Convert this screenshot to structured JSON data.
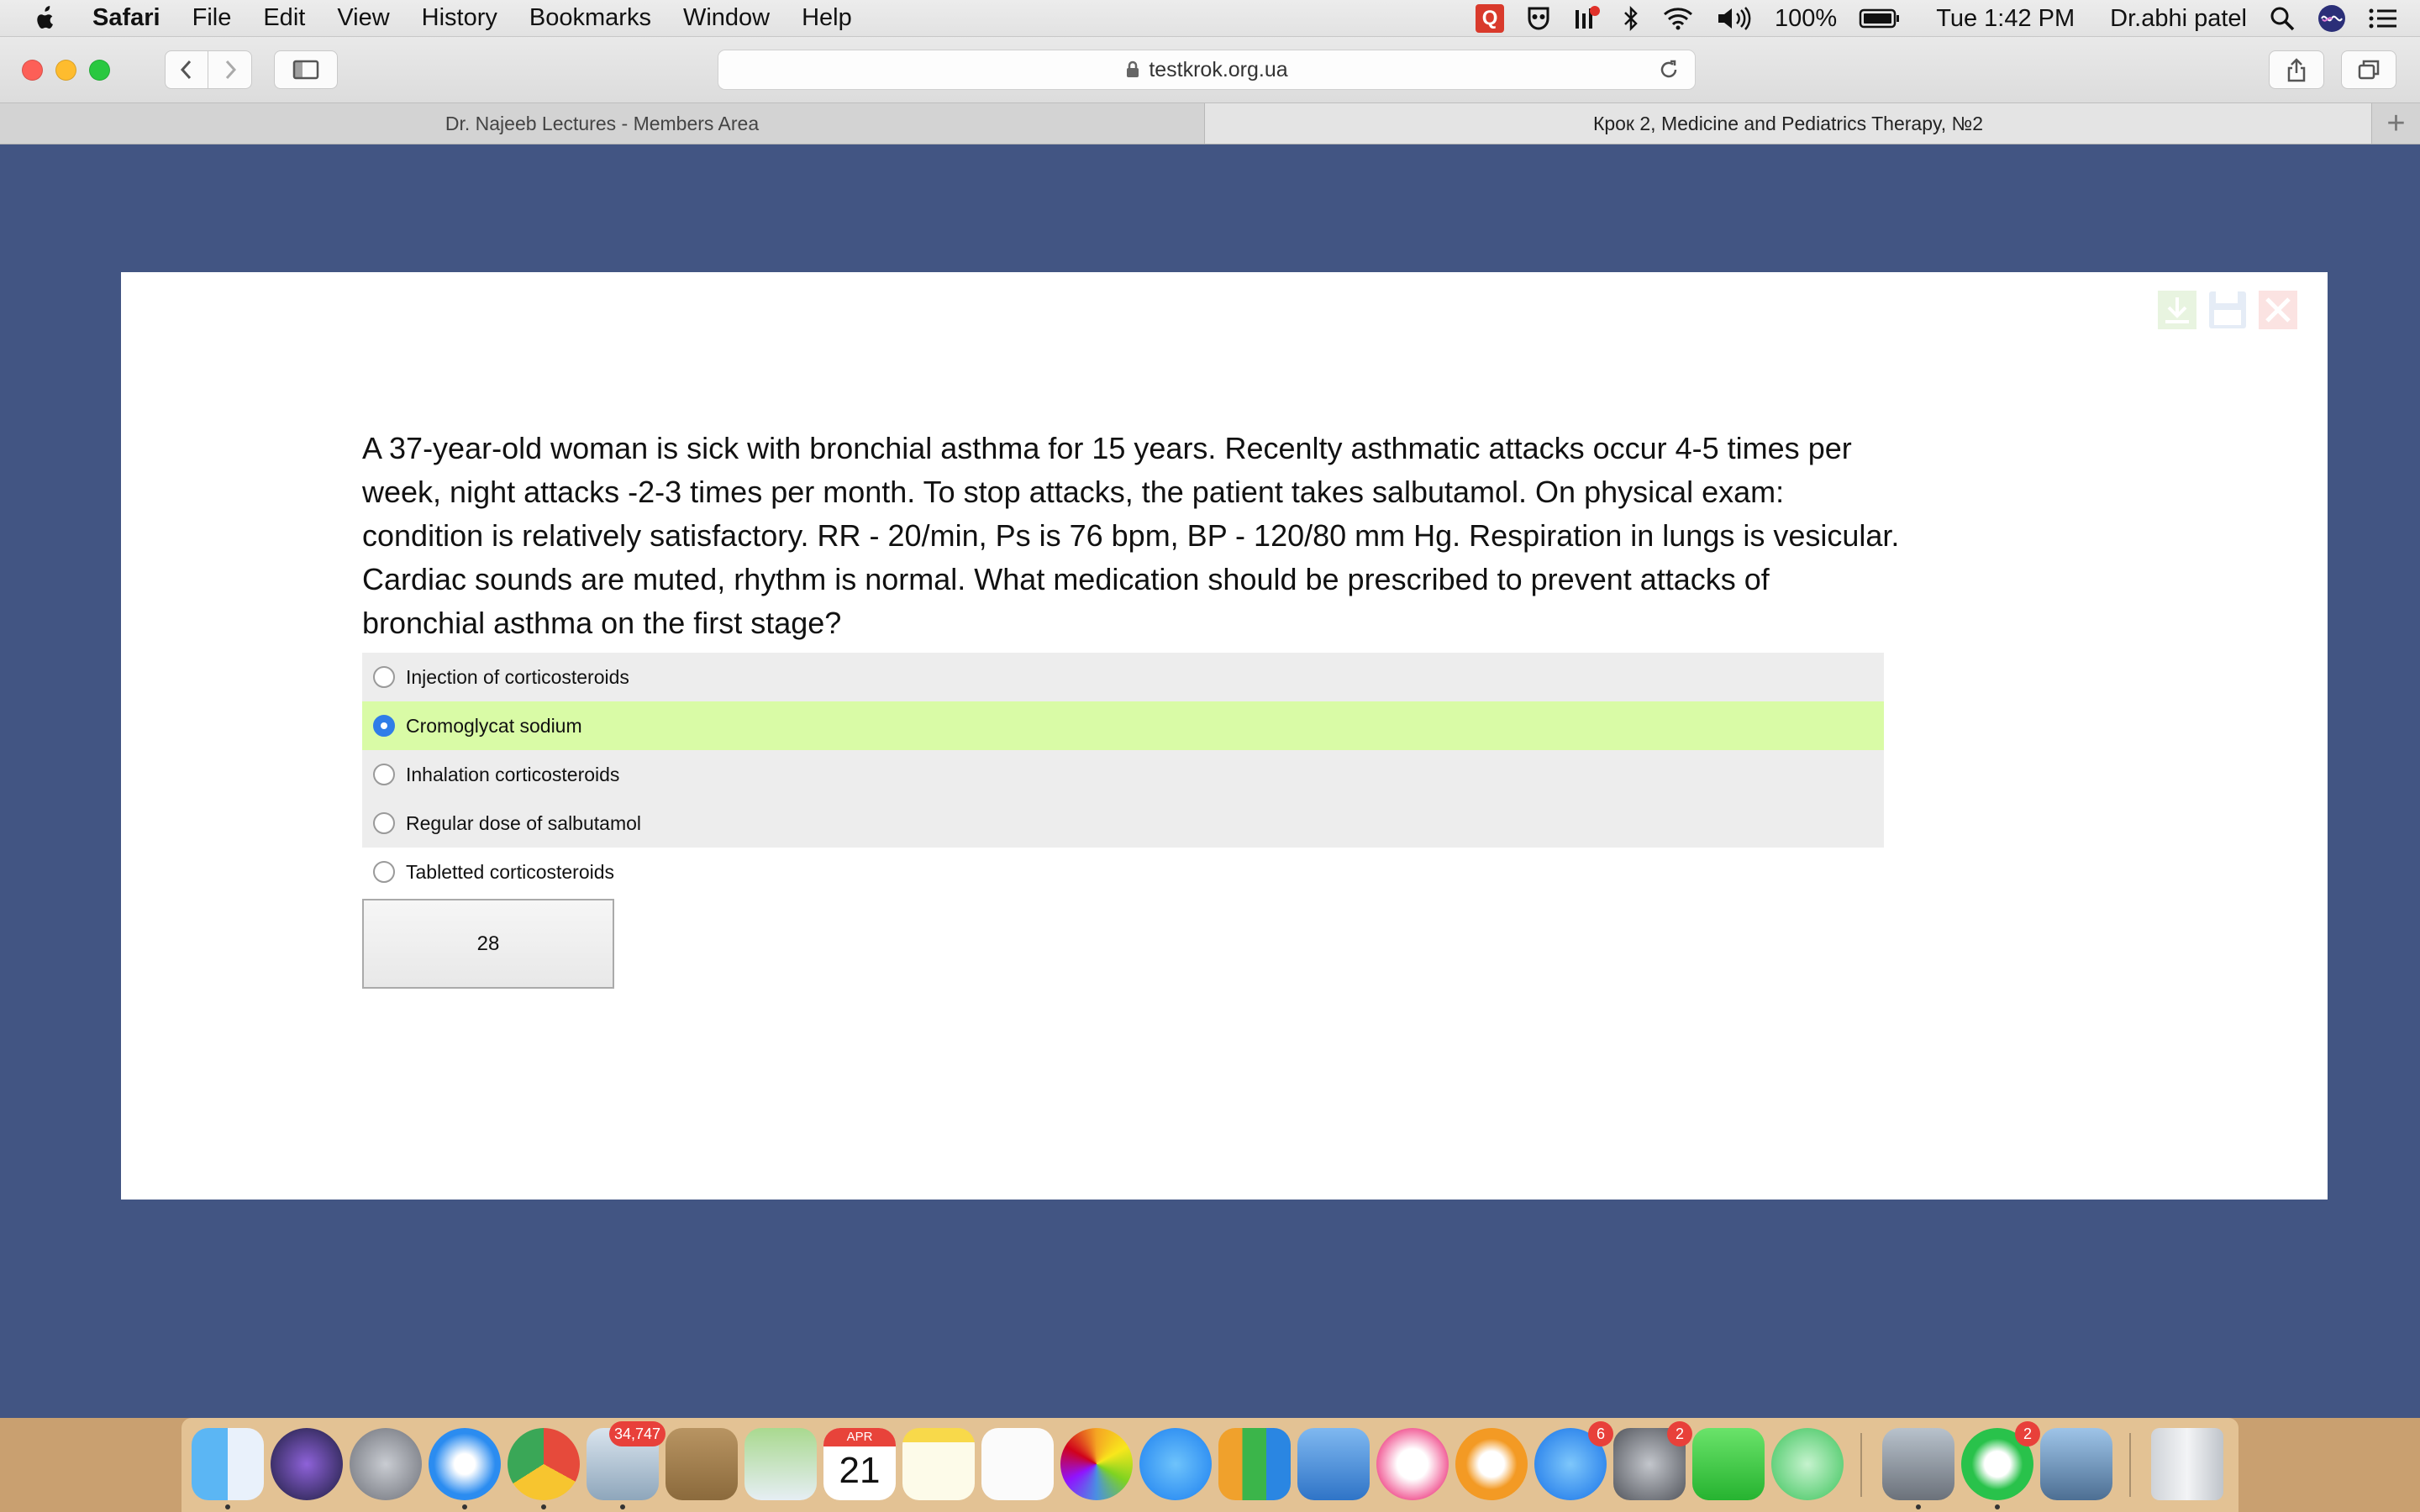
{
  "menubar": {
    "app_name": "Safari",
    "items": [
      "File",
      "Edit",
      "View",
      "History",
      "Bookmarks",
      "Window",
      "Help"
    ],
    "battery": "100%",
    "clock": "Tue 1:42 PM",
    "user": "Dr.abhi patel",
    "q_icon_label": "Q"
  },
  "browser": {
    "url": "testkrok.org.ua",
    "tabs": [
      {
        "label": "Dr. Najeeb Lectures - Members Area",
        "active": false
      },
      {
        "label": "Крок 2, Medicine and Pediatrics Therapy, №2",
        "active": true
      }
    ],
    "new_tab_label": "+"
  },
  "quiz": {
    "question": "A 37-year-old woman is sick with bronchial asthma for 15 years. Recenlty asthmatic attacks occur 4-5 times per week, night attacks -2-3 times per month. To stop attacks, the patient takes salbutamol. On physical exam: condition is relatively satisfactory. RR - 20/min, Ps is 76 bpm, BP - 120/80 mm Hg. Respiration in lungs is vesicular. Cardiac sounds are muted, rhythm is normal. What medication should be prescribed to prevent attacks of bronchial asthma on the first stage?",
    "answers": [
      {
        "label": "Injection of corticosteroids",
        "selected": false
      },
      {
        "label": "Cromoglycat sodium",
        "selected": true
      },
      {
        "label": "Inhalation corticosteroids",
        "selected": false
      },
      {
        "label": "Regular dose of salbutamol",
        "selected": false
      },
      {
        "label": "Tabletted corticosteroids",
        "selected": false
      }
    ],
    "button_label": "28",
    "selected_color": "#d9fba6"
  },
  "dock": {
    "mail_badge": "34,747",
    "calendar_month": "APR",
    "calendar_day": "21",
    "appstore_badge": "6",
    "prefs_badge": "2",
    "whatsapp_badge": "2"
  },
  "colors": {
    "page_background": "#425583",
    "radio_checked": "#2f7de8"
  }
}
